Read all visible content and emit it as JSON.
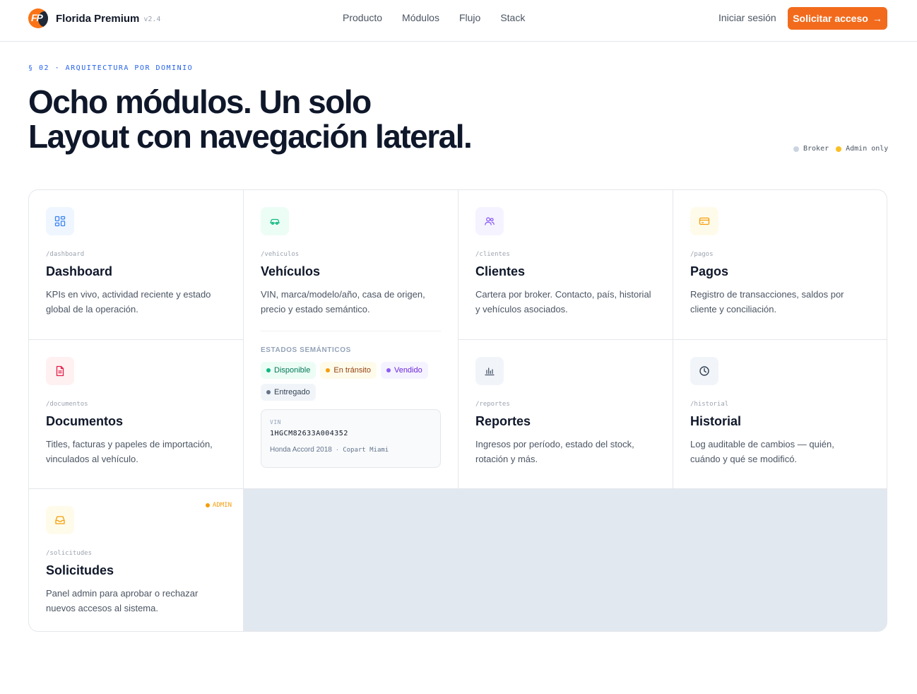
{
  "nav": {
    "brand_name": "Florida Premium",
    "version": "v2.4",
    "links": [
      "Producto",
      "Módulos",
      "Flujo",
      "Stack"
    ],
    "login": "Iniciar sesión",
    "cta": "Solicitar acceso",
    "cta_icon": "→"
  },
  "header": {
    "eyebrow": "§ 02 · ARQUITECTURA POR DOMINIO",
    "title_line1": "Ocho módulos. Un solo",
    "title_line2": "Layout con navegación lateral.",
    "legend": [
      {
        "label": "Broker",
        "color": "#cbd5e1"
      },
      {
        "label": "Admin only",
        "color": "#fbbf24"
      }
    ]
  },
  "modules": [
    {
      "route": "/dashboard",
      "title": "Dashboard",
      "desc": "KPIs en vivo, actividad reciente y estado global de la operación.",
      "icon": "dashboard-icon"
    },
    {
      "route": "/vehiculos",
      "title": "Vehículos",
      "desc": "VIN, marca/modelo/año, casa de origen, precio y estado semántico.",
      "icon": "car-icon"
    },
    {
      "route": "/clientes",
      "title": "Clientes",
      "desc": "Cartera por broker. Contacto, país, historial y vehículos asociados.",
      "icon": "users-icon"
    },
    {
      "route": "/pagos",
      "title": "Pagos",
      "desc": "Registro de transacciones, saldos por cliente y conciliación.",
      "icon": "credit-card-icon"
    },
    {
      "route": "/documentos",
      "title": "Documentos",
      "desc": "Titles, facturas y papeles de importación, vinculados al vehículo.",
      "icon": "document-icon"
    },
    {
      "route": "/reportes",
      "title": "Reportes",
      "desc": "Ingresos por período, estado del stock, rotación y más.",
      "icon": "bar-chart-icon"
    },
    {
      "route": "/historial",
      "title": "Historial",
      "desc": "Log auditable de cambios — quién, cuándo y qué se modificó.",
      "icon": "clock-icon"
    },
    {
      "route": "/solicitudes",
      "title": "Solicitudes",
      "desc": "Panel admin para aprobar o rechazar nuevos accesos al sistema.",
      "icon": "inbox-icon",
      "badge": "ADMIN"
    }
  ],
  "vehicle_states": {
    "label": "ESTADOS SEMÁNTICOS",
    "chips": [
      {
        "label": "Disponible",
        "bg": "#ecfdf5",
        "fg": "#047857",
        "dot": "#10b981"
      },
      {
        "label": "En tránsito",
        "bg": "#fffbeb",
        "fg": "#92400e",
        "dot": "#f59e0b"
      },
      {
        "label": "Vendido",
        "bg": "#f5f3ff",
        "fg": "#6d28d9",
        "dot": "#8b5cf6"
      },
      {
        "label": "Entregado",
        "bg": "#f1f5f9",
        "fg": "#334155",
        "dot": "#64748b"
      }
    ],
    "vin_label": "VIN",
    "vin_value": "1HGCM82633A004352",
    "vin_car": "Honda Accord 2018",
    "vin_sep": "·",
    "vin_origin": "Copart Miami"
  },
  "colors": {
    "accent": "#f26b1d",
    "eyebrow": "#2563eb"
  }
}
